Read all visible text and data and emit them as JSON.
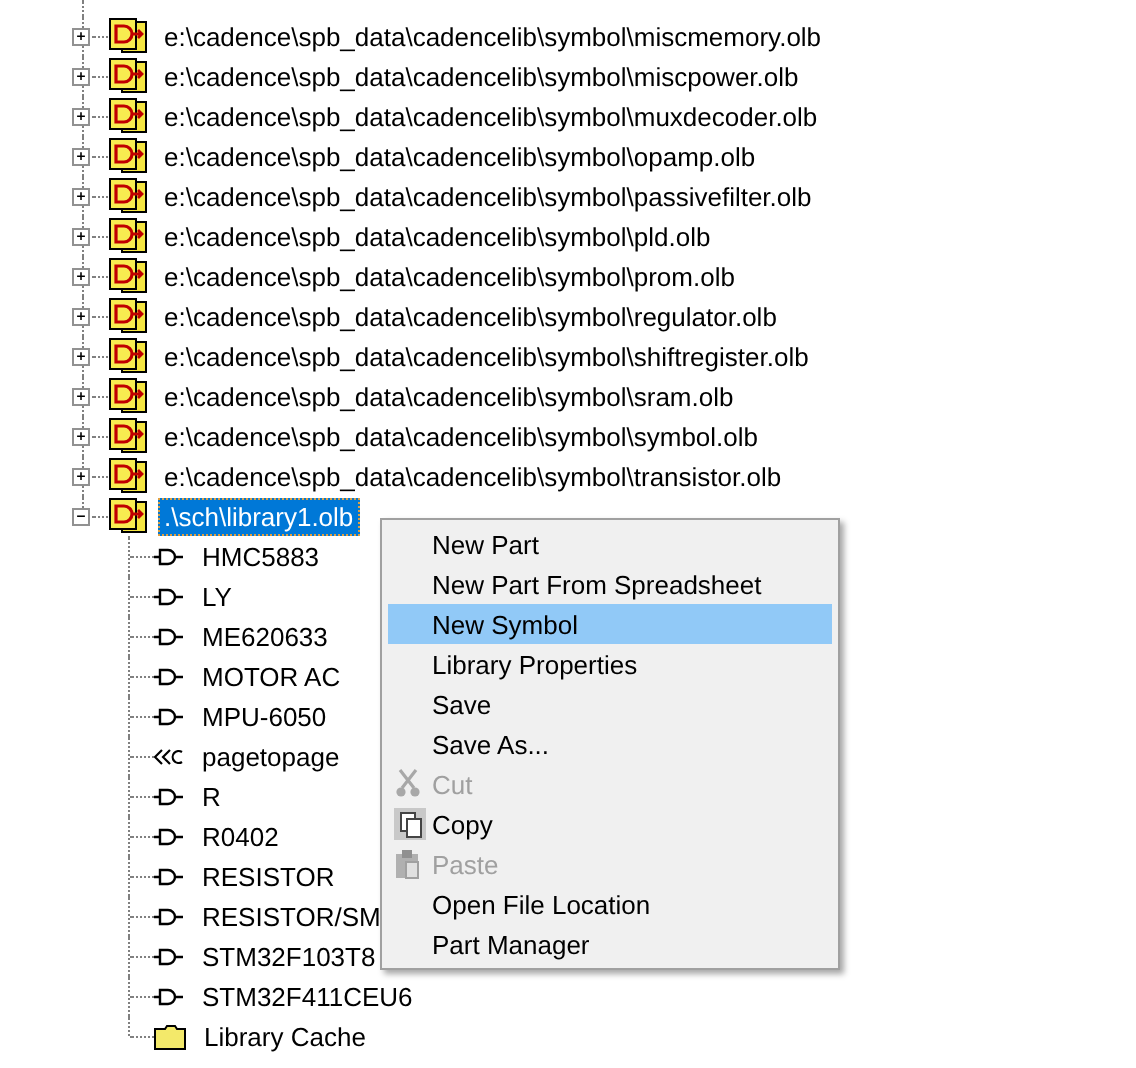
{
  "tree": {
    "libraries": [
      {
        "name": "e:\\cadence\\spb_data\\cadencelib\\symbol\\miscmemory.olb",
        "expanded": false,
        "selected": false
      },
      {
        "name": "e:\\cadence\\spb_data\\cadencelib\\symbol\\miscpower.olb",
        "expanded": false,
        "selected": false
      },
      {
        "name": "e:\\cadence\\spb_data\\cadencelib\\symbol\\muxdecoder.olb",
        "expanded": false,
        "selected": false
      },
      {
        "name": "e:\\cadence\\spb_data\\cadencelib\\symbol\\opamp.olb",
        "expanded": false,
        "selected": false
      },
      {
        "name": "e:\\cadence\\spb_data\\cadencelib\\symbol\\passivefilter.olb",
        "expanded": false,
        "selected": false
      },
      {
        "name": "e:\\cadence\\spb_data\\cadencelib\\symbol\\pld.olb",
        "expanded": false,
        "selected": false
      },
      {
        "name": "e:\\cadence\\spb_data\\cadencelib\\symbol\\prom.olb",
        "expanded": false,
        "selected": false
      },
      {
        "name": "e:\\cadence\\spb_data\\cadencelib\\symbol\\regulator.olb",
        "expanded": false,
        "selected": false
      },
      {
        "name": "e:\\cadence\\spb_data\\cadencelib\\symbol\\shiftregister.olb",
        "expanded": false,
        "selected": false
      },
      {
        "name": "e:\\cadence\\spb_data\\cadencelib\\symbol\\sram.olb",
        "expanded": false,
        "selected": false
      },
      {
        "name": "e:\\cadence\\spb_data\\cadencelib\\symbol\\symbol.olb",
        "expanded": false,
        "selected": false
      },
      {
        "name": "e:\\cadence\\spb_data\\cadencelib\\symbol\\transistor.olb",
        "expanded": false,
        "selected": false
      },
      {
        "name": ".\\sch\\library1.olb",
        "expanded": true,
        "selected": true,
        "children": [
          {
            "name": "HMC5883",
            "kind": "part"
          },
          {
            "name": "LY",
            "kind": "part"
          },
          {
            "name": "ME620633",
            "kind": "part"
          },
          {
            "name": "MOTOR AC",
            "kind": "part"
          },
          {
            "name": "MPU-6050",
            "kind": "part"
          },
          {
            "name": "pagetopage",
            "kind": "offpage"
          },
          {
            "name": "R",
            "kind": "part"
          },
          {
            "name": "R0402",
            "kind": "part"
          },
          {
            "name": "RESISTOR",
            "kind": "part"
          },
          {
            "name": "RESISTOR/SM",
            "kind": "part"
          },
          {
            "name": "STM32F103T8",
            "kind": "part"
          },
          {
            "name": "STM32F411CEU6",
            "kind": "part"
          },
          {
            "name": "Library Cache",
            "kind": "folder"
          }
        ]
      }
    ]
  },
  "context_menu": {
    "items": [
      {
        "label": "New Part",
        "kind": "plain",
        "disabled": false,
        "selected": false
      },
      {
        "label": "New Part From Spreadsheet",
        "kind": "plain",
        "disabled": false,
        "selected": false
      },
      {
        "label": "New Symbol",
        "kind": "plain",
        "disabled": false,
        "selected": true
      },
      {
        "label": "Library Properties",
        "kind": "plain",
        "disabled": false,
        "selected": false
      },
      {
        "label": "Save",
        "kind": "plain",
        "disabled": false,
        "selected": false
      },
      {
        "label": "Save As...",
        "kind": "plain",
        "disabled": false,
        "selected": false
      },
      {
        "label": "Cut",
        "kind": "cut",
        "disabled": true,
        "selected": false
      },
      {
        "label": "Copy",
        "kind": "copy",
        "disabled": false,
        "selected": false
      },
      {
        "label": "Paste",
        "kind": "paste",
        "disabled": true,
        "selected": false
      },
      {
        "label": "Open File Location",
        "kind": "plain",
        "disabled": false,
        "selected": false
      },
      {
        "label": "Part Manager",
        "kind": "plain",
        "disabled": false,
        "selected": false
      }
    ]
  }
}
